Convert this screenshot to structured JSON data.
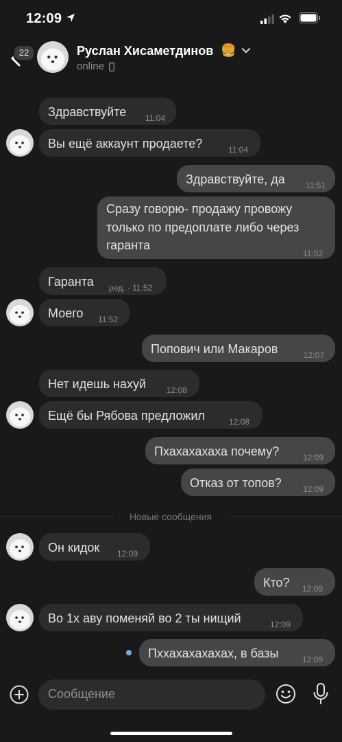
{
  "status_bar": {
    "time": "12:09"
  },
  "header": {
    "unread_count": "22",
    "name": "Руслан Хисаметдинов",
    "emoji": "🍔",
    "status": "online"
  },
  "messages": [
    {
      "dir": "in",
      "text": "Здравствуйте",
      "time": "11:04"
    },
    {
      "dir": "in",
      "text": "Вы ещё аккаунт продаете?",
      "time": "11:04"
    },
    {
      "dir": "out",
      "text": "Здравствуйте, да",
      "time": "11:51"
    },
    {
      "dir": "out",
      "lines": [
        "Сразу говорю- продажу провожу",
        "только по предоплате либо через",
        "гаранта"
      ],
      "time": "11:52"
    },
    {
      "dir": "in",
      "text": "Гаранта",
      "time": "ред. · 11:52"
    },
    {
      "dir": "in",
      "text": "Моего",
      "time": "11:52"
    },
    {
      "dir": "out",
      "text": "Попович или Макаров",
      "time": "12:07"
    },
    {
      "dir": "in",
      "text": "Нет идешь нахуй",
      "time": "12:08"
    },
    {
      "dir": "in",
      "text": "Ещё бы Рябова предложил",
      "time": "12:08"
    },
    {
      "dir": "out",
      "text": "Пхахахахаха почему?",
      "time": "12:09"
    },
    {
      "dir": "out",
      "text": "Отказ от топов?",
      "time": "12:09"
    },
    {
      "dir": "in",
      "text": "Он кидок",
      "time": "12:09"
    },
    {
      "dir": "out",
      "text": "Кто?",
      "time": "12:09"
    },
    {
      "dir": "in",
      "text": "Во 1х аву поменяй во 2 ты нищий",
      "time": "12:09"
    },
    {
      "dir": "out",
      "text": "Пххахахахахах, в базы",
      "time": "12:09"
    }
  ],
  "new_messages_label": "Новые сообщения",
  "composer": {
    "placeholder": "Сообщение"
  },
  "colors": {
    "background": "#191919",
    "incoming": "#2c2c2e",
    "outgoing": "#454647",
    "unread_dot": "#71aaeb"
  }
}
